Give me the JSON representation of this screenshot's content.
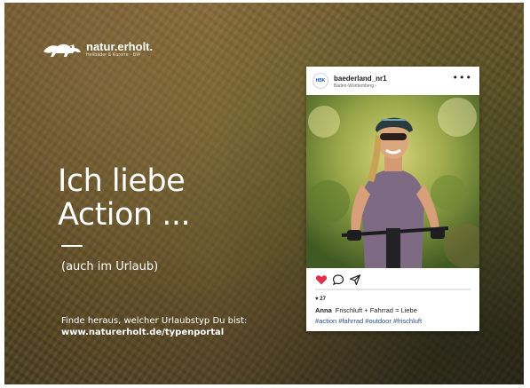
{
  "brand": {
    "name": "natur.erholt.",
    "tagline": "Heilbäder & Kurorte · BW"
  },
  "headline": {
    "line1": "Ich liebe",
    "line2": "Action ..."
  },
  "subline": "(auch im Urlaub)",
  "cta": {
    "text": "Finde heraus, welcher Urlaubstyp Du bist:",
    "url": "www.naturerholt.de/typenportal"
  },
  "post": {
    "avatar_text": "HBK",
    "username": "baederland_nr1",
    "location": "Baden-Württemberg ›",
    "more": "•••",
    "likes": "♥ 27",
    "caption_author": "Anna",
    "caption_text": "Frischluft + Fahrrad = Liebe",
    "hashtags": "#action #fahrrad #outdoor #frischluft",
    "progress_fraction": 1.0
  },
  "colors": {
    "heart": "#e0304a",
    "hashtag": "#2c4c8c",
    "brand_blue": "#1b5aa8"
  }
}
